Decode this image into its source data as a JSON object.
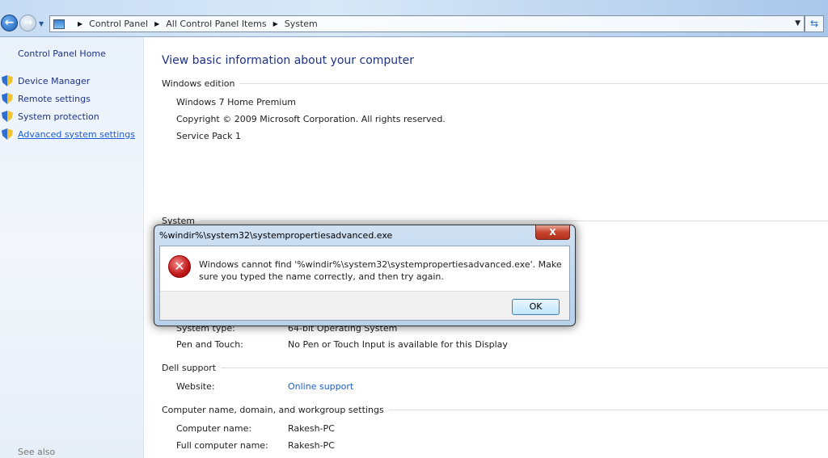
{
  "address": {
    "crumbs": [
      "Control Panel",
      "All Control Panel Items",
      "System"
    ]
  },
  "sidebar": {
    "home": "Control Panel Home",
    "items": [
      {
        "label": "Device Manager"
      },
      {
        "label": "Remote settings"
      },
      {
        "label": "System protection"
      },
      {
        "label": "Advanced system settings"
      }
    ],
    "see_also": "See also"
  },
  "main": {
    "title": "View basic information about your computer",
    "edition": {
      "header": "Windows edition",
      "lines": [
        "Windows 7 Home Premium",
        "Copyright © 2009 Microsoft Corporation.  All rights reserved.",
        "Service Pack 1"
      ]
    },
    "system": {
      "header": "System",
      "rows": [
        {
          "label": "System type:",
          "value": "64-bit Operating System"
        },
        {
          "label": "Pen and Touch:",
          "value": "No Pen or Touch Input is available for this Display"
        }
      ]
    },
    "dell": {
      "header": "Dell support",
      "label": "Website:",
      "link": "Online support"
    },
    "computer": {
      "header": "Computer name, domain, and workgroup settings",
      "rows": [
        {
          "label": "Computer name:",
          "value": "Rakesh-PC"
        },
        {
          "label": "Full computer name:",
          "value": "Rakesh-PC"
        }
      ]
    }
  },
  "dialog": {
    "title": "%windir%\\system32\\systempropertiesadvanced.exe",
    "message": "Windows cannot find '%windir%\\system32\\systempropertiesadvanced.exe'. Make sure you typed the name correctly, and then try again.",
    "ok": "OK",
    "close": "X"
  }
}
